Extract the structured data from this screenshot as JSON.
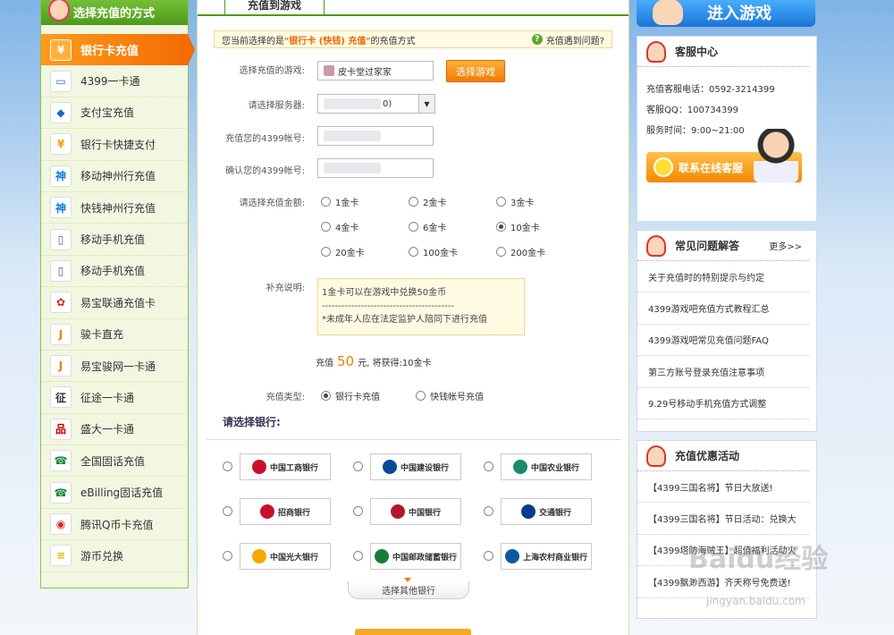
{
  "sidebar": {
    "title": "选择充值的方式",
    "items": [
      {
        "label": "银行卡充值",
        "icon": "¥",
        "color": "#f27c00"
      },
      {
        "label": "4399一卡通",
        "icon": "▭",
        "color": "#2a6fd6"
      },
      {
        "label": "支付宝充值",
        "icon": "◆",
        "color": "#1a66c8"
      },
      {
        "label": "银行卡快捷支付",
        "icon": "¥",
        "color": "#f2a000"
      },
      {
        "label": "移动神州行充值",
        "icon": "神",
        "color": "#0a7fd8"
      },
      {
        "label": "快钱神州行充值",
        "icon": "神",
        "color": "#0a7fd8"
      },
      {
        "label": "移动手机充值",
        "icon": "▯",
        "color": "#557"
      },
      {
        "label": "移动手机充值",
        "icon": "▯",
        "color": "#557"
      },
      {
        "label": "易宝联通充值卡",
        "icon": "✿",
        "color": "#d22"
      },
      {
        "label": "骏卡直充",
        "icon": "J",
        "color": "#f27c00"
      },
      {
        "label": "易宝骏网一卡通",
        "icon": "J",
        "color": "#f27c00"
      },
      {
        "label": "征途一卡通",
        "icon": "征",
        "color": "#333"
      },
      {
        "label": "盛大一卡通",
        "icon": "品",
        "color": "#c00"
      },
      {
        "label": "全国固话充值",
        "icon": "☎",
        "color": "#1a8a3a"
      },
      {
        "label": "eBilling固话充值",
        "icon": "☎",
        "color": "#1a8a3a"
      },
      {
        "label": "腾讯Q币卡充值",
        "icon": "◉",
        "color": "#d22"
      },
      {
        "label": "游币兑换",
        "icon": "≡",
        "color": "#e6b400"
      }
    ]
  },
  "tab": {
    "label": "充值到游戏"
  },
  "notice": {
    "prefix": "您当前选择的是",
    "highlight": "\"银行卡 (快钱) 充值\"",
    "suffix": "的充值方式",
    "help": "充值遇到问题?"
  },
  "form": {
    "game_label": "选择充值的游戏:",
    "game_value": "皮卡堂过家家",
    "game_button": "选择游戏",
    "server_label": "请选择服务器:",
    "server_suffix": "0)",
    "account_label": "充值您的4399帐号:",
    "confirm_label": "确认您的4399帐号:",
    "amount_label": "请选择充值金额:",
    "amounts": [
      "1金卡",
      "2金卡",
      "3金卡",
      "4金卡",
      "6金卡",
      "10金卡",
      "20金卡",
      "100金卡",
      "200金卡"
    ],
    "selected_amount": "10金卡",
    "note_label": "补充说明:",
    "note_lines": [
      "1金卡可以在游戏中兑换50金币",
      "-----------------------------------------",
      "*未成年人应在法定监护人陪同下进行充值"
    ],
    "summary_prefix": "充值",
    "summary_amount": "50",
    "summary_suffix": "元, 将获得:10金卡",
    "type_label": "充值类型:",
    "type_options": [
      "银行卡充值",
      "快钱帐号充值"
    ],
    "selected_type": "银行卡充值"
  },
  "banks": {
    "title": "请选择银行:",
    "items": [
      {
        "name": "中国工商银行",
        "color": "#c8102e"
      },
      {
        "name": "中国建设银行",
        "color": "#0a4a9a"
      },
      {
        "name": "中国农业银行",
        "color": "#1a8a6a"
      },
      {
        "name": "招商银行",
        "color": "#c8102e"
      },
      {
        "name": "中国银行",
        "color": "#b0182a"
      },
      {
        "name": "交通银行",
        "color": "#0a3a8a"
      },
      {
        "name": "中国光大银行",
        "color": "#f5a800"
      },
      {
        "name": "中国邮政储蓄银行",
        "color": "#1a7a3a"
      },
      {
        "name": "上海农村商业银行",
        "color": "#0a5aa0"
      }
    ],
    "more": "选择其他银行"
  },
  "right": {
    "enter_game": "进入游戏",
    "service": {
      "title": "客服中心",
      "phone": "充值客服电话：0592-3214399",
      "qq": "客服QQ：100734399",
      "hours": "服务时间：9:00~21:00",
      "chat": "联系在线客服"
    },
    "faq": {
      "title": "常见问题解答",
      "more": "更多>>",
      "items": [
        "关于充值时的特别提示与约定",
        "4399游戏吧充值方式教程汇总",
        "4399游戏吧常见充值问题FAQ",
        "第三方账号登录充值注意事项",
        "9.29号移动手机充值方式调整"
      ]
    },
    "promo": {
      "title": "充值优惠活动",
      "items": [
        "【4399三国名将】节日大放送!",
        "【4399三国名将】节日活动：兑换大",
        "【4399塔防海贼王】超值福利活动火",
        "【4399飘渺西游】齐天称号免费送!"
      ]
    }
  },
  "watermark": {
    "text": "Baidu经验",
    "sub": "jingyan.baidu.com"
  }
}
